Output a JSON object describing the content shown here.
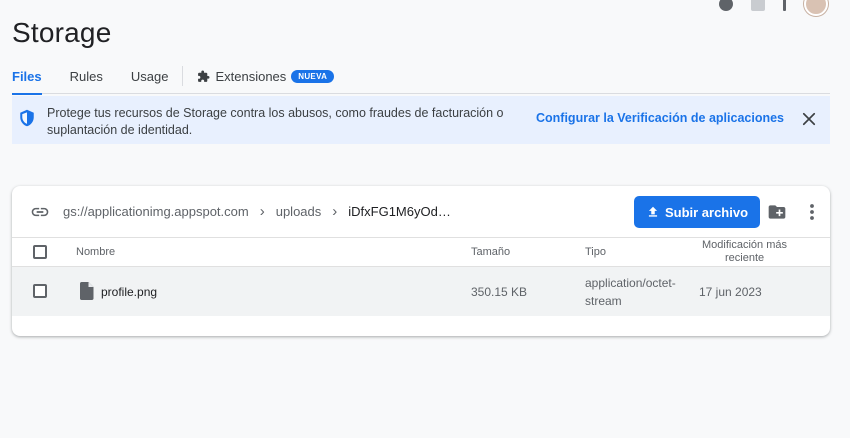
{
  "page": {
    "title": "Storage"
  },
  "tabs": [
    {
      "label": "Files",
      "active": true
    },
    {
      "label": "Rules",
      "active": false
    },
    {
      "label": "Usage",
      "active": false
    }
  ],
  "extensions": {
    "label": "Extensiones",
    "badge": "NUEVA"
  },
  "banner": {
    "text": "Protege tus recursos de Storage contra los abusos, como fraudes de facturación o suplantación de identidad.",
    "link": "Configurar la Verificación de aplicaciones"
  },
  "browser": {
    "breadcrumbs": [
      "gs://applicationimg.appspot.com",
      "uploads",
      "iDfxFG1M6yOd…"
    ],
    "upload_label": "Subir archivo",
    "columns": {
      "name": "Nombre",
      "size": "Tamaño",
      "type": "Tipo",
      "modified_1": "Modificación más",
      "modified_2": "reciente"
    },
    "rows": [
      {
        "name": "profile.png",
        "size": "350.15 KB",
        "type_1": "application/octet-",
        "type_2": "stream",
        "modified": "17 jun 2023"
      }
    ]
  },
  "colors": {
    "accent": "#1a73e8",
    "banner_bg": "#e8f0fe",
    "page_bg": "#f8f9fa"
  }
}
